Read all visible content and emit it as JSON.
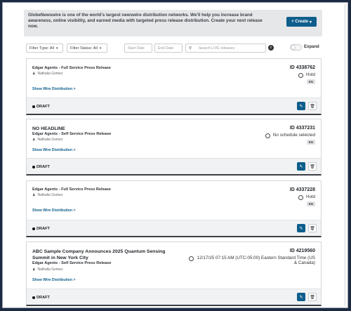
{
  "banner": {
    "text": "GlobeNewswire is one of the world's largest newswire distribution networks. We'll help you increase brand awareness, online visibility, and earned media with targeted press release distribution. Create your next release now.",
    "create_label": "+ Create",
    "create_caret": "▾"
  },
  "filters": {
    "filter_type": "Filter Type: All",
    "filter_status": "Filter Status: All",
    "start_date": "Start Date",
    "end_date": "End Date",
    "search_placeholder": "Search LIVE releases",
    "info_glyph": "i",
    "expand_label": "Expand"
  },
  "icons": {
    "search": "search-icon",
    "info": "info-icon",
    "edit": "pencil-icon",
    "delete": "trash-icon",
    "clock": "clock-icon",
    "person": "person-icon"
  },
  "colors": {
    "brand_blue": "#0e5e8c",
    "banner_bg": "#e6e7e9",
    "frame_bg": "#1c2a44"
  },
  "releases": [
    {
      "headline": "",
      "type": "Edgar Agents - Full Service Press Release",
      "author": "Nathalia Gomez",
      "wire_link": "Show Wire Distribution >",
      "id": "ID 4338762",
      "schedule": "Hold",
      "lang": "EN",
      "status": "DRAFT"
    },
    {
      "headline": "NO HEADLINE",
      "type": "Edgar Agents - Self Service Press Release",
      "author": "Nathalia Gomez",
      "wire_link": "Show Wire Distribution >",
      "id": "ID 4337231",
      "schedule": "No schedule selected",
      "lang": "EN",
      "status": "DRAFT"
    },
    {
      "headline": "",
      "type": "Edgar Agents - Full Service Press Release",
      "author": "Nathalia Gomez",
      "wire_link": "Show Wire Distribution >",
      "id": "ID 4337228",
      "schedule": "Hold",
      "lang": "EN",
      "status": "DRAFT"
    },
    {
      "headline": "ABC Sample Company Announces 2025 Quantum Sensing Summit in New York City",
      "type": "Edgar Agents - Self Service Press Release",
      "author": "Nathalia Gomez",
      "wire_link": "Show Wire Distribution >",
      "id": "ID 4219560",
      "schedule": "12/17/25 07:15 AM (UTC-05:00) Eastern Standard Time (US & Canada)",
      "lang": "EN",
      "status": "DRAFT"
    }
  ]
}
